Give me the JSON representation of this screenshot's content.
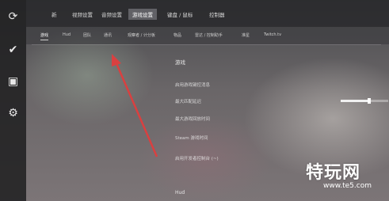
{
  "sidebar": {
    "items": [
      {
        "icon": "refresh-icon",
        "glyph": "⟳"
      },
      {
        "icon": "check-icon",
        "glyph": "✔"
      },
      {
        "icon": "folder-icon",
        "glyph": "▣"
      },
      {
        "icon": "gear-icon",
        "glyph": "⚙"
      }
    ]
  },
  "topbar": {
    "tabs": [
      {
        "label": "新"
      },
      {
        "label": "视频设置"
      },
      {
        "label": "音频设置"
      },
      {
        "label": "游戏设置",
        "active": true
      },
      {
        "label": "键盘 / 鼠标"
      },
      {
        "label": "控制器"
      }
    ]
  },
  "subtabs": [
    {
      "label": "游戏",
      "active": true
    },
    {
      "label": "Hud"
    },
    {
      "label": "团队"
    },
    {
      "label": "通讯"
    },
    {
      "label": "观察者 / 计分板"
    },
    {
      "label": "物品"
    },
    {
      "label": "雷达 / 控制助手"
    },
    {
      "label": "准星"
    },
    {
      "label": "Twitch.tv"
    }
  ],
  "section": {
    "title": "游戏",
    "rows": [
      {
        "label": "启用游戏键控消息"
      },
      {
        "label": "最大匹配延迟"
      },
      {
        "label": "最大游戏回放时间"
      },
      {
        "label": "Steam 游戏时间"
      },
      {
        "label": "启用开发者控制台 (~)"
      }
    ],
    "slider_fraction": 0.6
  },
  "section2": {
    "title": "Hud"
  },
  "watermark": {
    "title": "特玩网",
    "url": "www.te5.com"
  },
  "colors": {
    "annotation_arrow": "#d94040"
  }
}
